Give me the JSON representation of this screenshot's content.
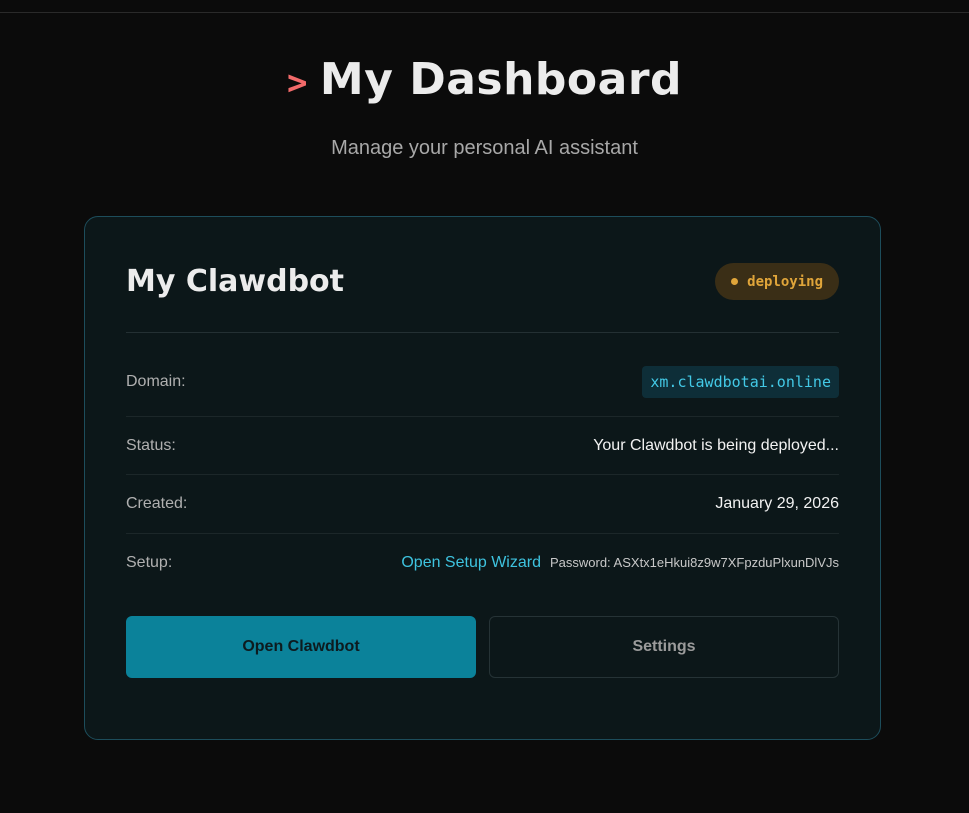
{
  "header": {
    "prompt_icon": ">",
    "title": "My Dashboard",
    "subtitle": "Manage your personal AI assistant"
  },
  "card": {
    "title": "My Clawdbot",
    "badge": {
      "label": "deploying",
      "color": "#e0a53a"
    },
    "rows": {
      "domain": {
        "label": "Domain:",
        "value": "xm.clawdbotai.online"
      },
      "status": {
        "label": "Status:",
        "value": "Your Clawdbot is being deployed..."
      },
      "created": {
        "label": "Created:",
        "value": "January 29, 2026"
      },
      "setup": {
        "label": "Setup:",
        "link_text": "Open Setup Wizard",
        "password_text": "Password: ASXtx1eHkui8z9w7XFpzduPlxunDlVJs"
      }
    },
    "buttons": {
      "primary_label": "Open Clawdbot",
      "secondary_label": "Settings"
    }
  },
  "colors": {
    "background": "#0b0b0b",
    "accent": "#0b829a",
    "link": "#3ec3df",
    "prompt": "#f26a6a"
  }
}
